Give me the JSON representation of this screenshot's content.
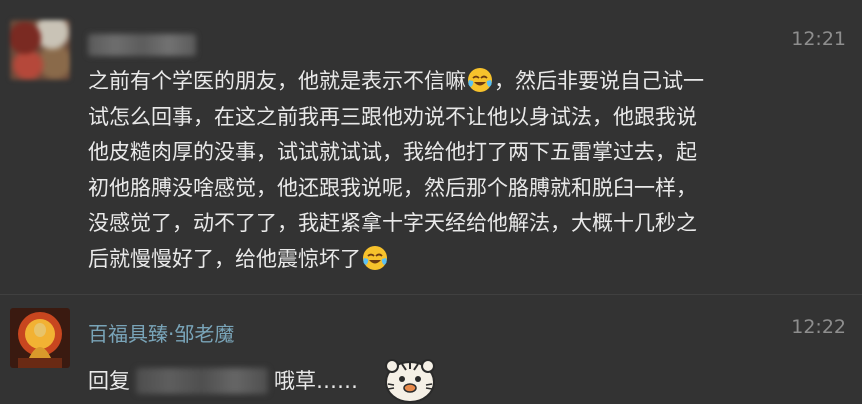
{
  "message1": {
    "time": "12:21",
    "lines": [
      "之前有个学医的朋友，他就是表示不信嘛",
      "，然后非要说自己试一",
      "试怎么回事，在这之前我再三跟他劝说不让他以身试法，他跟我说",
      "他皮糙肉厚的没事，试试就试试，我给他打了两下五雷掌过去，起",
      "初他胳膊没啥感觉，他还跟我说呢，然后那个胳膊就和脱臼一样，",
      "没感觉了，动不了了，我赶紧拿十字天经给他解法，大概十几秒之",
      "后就慢慢好了，给他震惊坏了"
    ],
    "emoji": "face-with-tears-of-joy-icon"
  },
  "message2": {
    "sender": "百福具臻·邹老魔",
    "time": "12:22",
    "reply_prefix": "回复",
    "reply_text": "哦草……",
    "sticker": "tiger-sticker-icon"
  },
  "colors": {
    "background": "#333333",
    "name": "#79a4b8",
    "text": "#e9e9e9",
    "time": "#8e8e8e"
  }
}
